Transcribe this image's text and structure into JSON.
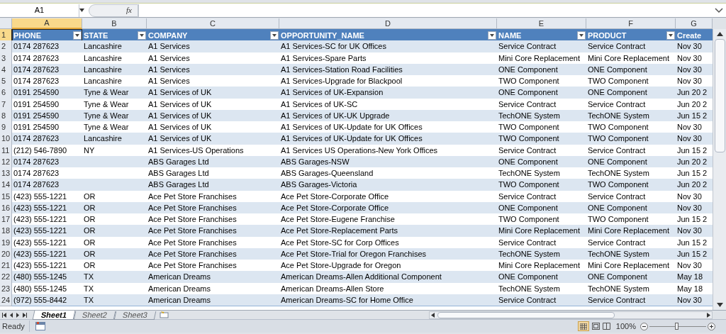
{
  "name_box": "A1",
  "function_label": "fx",
  "column_letters": [
    {
      "label": "A",
      "selected": true
    },
    {
      "label": "B",
      "selected": false
    },
    {
      "label": "C",
      "selected": false
    },
    {
      "label": "D",
      "selected": false
    },
    {
      "label": "E",
      "selected": false
    },
    {
      "label": "F",
      "selected": false
    },
    {
      "label": "G",
      "selected": false
    }
  ],
  "table": {
    "header_row_number": {
      "label": "1",
      "selected": true
    },
    "columns": [
      "PHONE",
      "STATE",
      "COMPANY",
      "OPPORTUNITY_NAME",
      "NAME",
      "PRODUCT",
      "Create"
    ],
    "rows": [
      {
        "number": "2",
        "cells": [
          "0174 287623",
          "Lancashire",
          "A1 Services",
          "A1 Services-SC for UK Offices",
          "Service Contract",
          "Service Contract",
          "Nov 30"
        ]
      },
      {
        "number": "3",
        "cells": [
          "0174 287623",
          "Lancashire",
          "A1 Services",
          "A1 Services-Spare Parts",
          "Mini Core Replacement",
          "Mini Core Replacement",
          "Nov 30"
        ]
      },
      {
        "number": "4",
        "cells": [
          "0174 287623",
          "Lancashire",
          "A1 Services",
          "A1 Services-Station Road Facilities",
          "ONE Component",
          "ONE Component",
          "Nov 30"
        ]
      },
      {
        "number": "5",
        "cells": [
          "0174 287623",
          "Lancashire",
          "A1 Services",
          "A1 Services-Upgrade for Blackpool",
          "TWO Component",
          "TWO Component",
          "Nov 30"
        ]
      },
      {
        "number": "6",
        "cells": [
          "0191 254590",
          "Tyne & Wear",
          "A1 Services of UK",
          "A1 Services of UK-Expansion",
          "ONE Component",
          "ONE Component",
          "Jun 20 2"
        ]
      },
      {
        "number": "7",
        "cells": [
          "0191 254590",
          "Tyne & Wear",
          "A1 Services of UK",
          "A1 Services of UK-SC",
          "Service Contract",
          "Service Contract",
          "Jun 20 2"
        ]
      },
      {
        "number": "8",
        "cells": [
          "0191 254590",
          "Tyne & Wear",
          "A1 Services of UK",
          "A1 Services of UK-UK Upgrade",
          "TechONE System",
          "TechONE System",
          "Jun 15 2"
        ]
      },
      {
        "number": "9",
        "cells": [
          "0191 254590",
          "Tyne & Wear",
          "A1 Services of UK",
          "A1 Services of UK-Update for UK Offices",
          "TWO Component",
          "TWO Component",
          "Nov 30"
        ]
      },
      {
        "number": "10",
        "cells": [
          "0174 287623",
          "Lancashire",
          "A1 Services of UK",
          "A1 Services of UK-Update for UK Offices",
          "TWO Component",
          "TWO Component",
          "Nov 30"
        ]
      },
      {
        "number": "11",
        "cells": [
          "(212) 546-7890",
          "NY",
          "A1 Services-US Operations",
          "A1 Services US Operations-New York Offices",
          "Service Contract",
          "Service Contract",
          "Jun 15 2"
        ]
      },
      {
        "number": "12",
        "cells": [
          "0174 287623",
          "",
          "ABS Garages Ltd",
          "ABS Garages-NSW",
          "ONE Component",
          "ONE Component",
          "Jun 20 2"
        ]
      },
      {
        "number": "13",
        "cells": [
          "0174 287623",
          "",
          "ABS Garages Ltd",
          "ABS Garages-Queensland",
          "TechONE System",
          "TechONE System",
          "Jun 15 2"
        ]
      },
      {
        "number": "14",
        "cells": [
          "0174 287623",
          "",
          "ABS Garages Ltd",
          "ABS Garages-Victoria",
          "TWO Component",
          "TWO Component",
          "Jun 20 2"
        ]
      },
      {
        "number": "15",
        "cells": [
          "(423) 555-1221",
          "OR",
          "Ace Pet Store Franchises",
          "Ace Pet Store-Corporate Office",
          "Service Contract",
          "Service Contract",
          "Nov 30"
        ]
      },
      {
        "number": "16",
        "cells": [
          "(423) 555-1221",
          "OR",
          "Ace Pet Store Franchises",
          "Ace Pet Store-Corporate Office",
          "ONE Component",
          "ONE Component",
          "Nov 30"
        ]
      },
      {
        "number": "17",
        "cells": [
          "(423) 555-1221",
          "OR",
          "Ace Pet Store Franchises",
          "Ace Pet Store-Eugene Franchise",
          "TWO Component",
          "TWO Component",
          "Jun 15 2"
        ]
      },
      {
        "number": "18",
        "cells": [
          "(423) 555-1221",
          "OR",
          "Ace Pet Store Franchises",
          "Ace Pet Store-Replacement Parts",
          "Mini Core Replacement",
          "Mini Core Replacement",
          "Nov 30"
        ]
      },
      {
        "number": "19",
        "cells": [
          "(423) 555-1221",
          "OR",
          "Ace Pet Store Franchises",
          "Ace Pet Store-SC for Corp Offices",
          "Service Contract",
          "Service Contract",
          "Jun 15 2"
        ]
      },
      {
        "number": "20",
        "cells": [
          "(423) 555-1221",
          "OR",
          "Ace Pet Store Franchises",
          "Ace Pet Store-Trial for Oregon Franchises",
          "TechONE System",
          "TechONE System",
          "Jun 15 2"
        ]
      },
      {
        "number": "21",
        "cells": [
          "(423) 555-1221",
          "OR",
          "Ace Pet Store Franchises",
          "Ace Pet Store-Upgrade for Oregon",
          "Mini Core Replacement",
          "Mini Core Replacement",
          "Nov 30"
        ]
      },
      {
        "number": "22",
        "cells": [
          "(480) 555-1245",
          "TX",
          "American Dreams",
          "American Dreams-Allen Additional Component",
          "ONE Component",
          "ONE Component",
          "May 18"
        ]
      },
      {
        "number": "23",
        "cells": [
          "(480) 555-1245",
          "TX",
          "American Dreams",
          "American Dreams-Allen Store",
          "TechONE System",
          "TechONE System",
          "May 18"
        ]
      },
      {
        "number": "24",
        "cells": [
          "(972) 555-8442",
          "TX",
          "American Dreams",
          "American Dreams-SC for Home Office",
          "Service Contract",
          "Service Contract",
          "Nov 30"
        ]
      }
    ]
  },
  "sheet_tabs": [
    {
      "label": "Sheet1",
      "selected": true
    },
    {
      "label": "Sheet2",
      "selected": false
    },
    {
      "label": "Sheet3",
      "selected": false
    }
  ],
  "status_bar": {
    "mode": "Ready",
    "zoom": "100%",
    "zoom_slider": {
      "level": 0.48
    }
  }
}
